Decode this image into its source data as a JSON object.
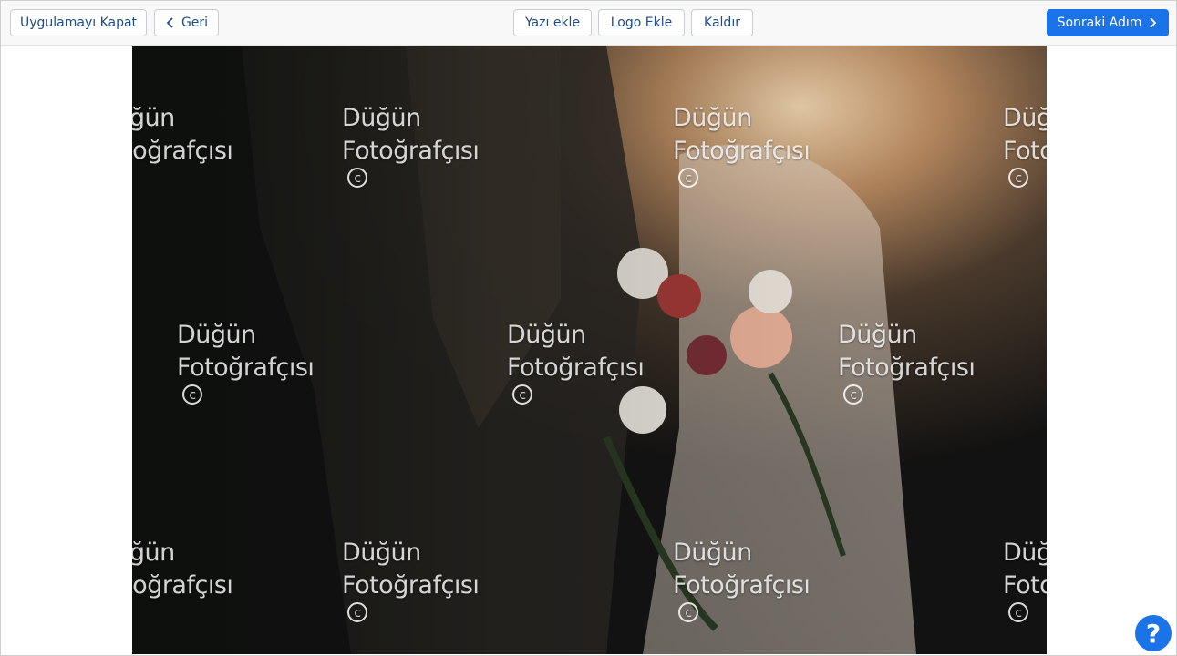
{
  "toolbar": {
    "close_label": "Uygulamayı Kapat",
    "back_label": "Geri",
    "add_text_label": "Yazı ekle",
    "add_logo_label": "Logo Ekle",
    "remove_label": "Kaldır",
    "next_label": "Sonraki Adım",
    "accent_color": "#1a73e8"
  },
  "watermark": {
    "line1": "Düğün",
    "line2": "Fotoğrafçısı",
    "copyright_symbol": "c"
  },
  "help": {
    "label": "?"
  },
  "icons": {
    "back": "chevron-left-icon",
    "next": "chevron-right-icon",
    "help": "help-icon",
    "copyright": "copyright-icon"
  }
}
